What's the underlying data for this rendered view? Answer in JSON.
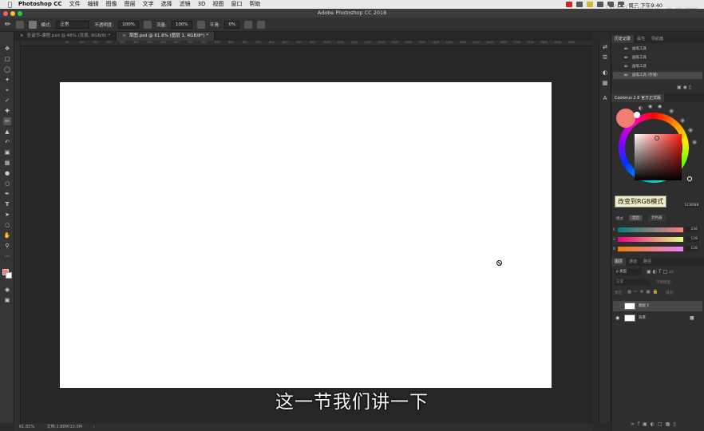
{
  "menubar": {
    "app": "Photoshop CC",
    "items": [
      "文件",
      "编辑",
      "图像",
      "图层",
      "文字",
      "选择",
      "滤镜",
      "3D",
      "视图",
      "窗口",
      "帮助"
    ],
    "clock": "周三 下午9:40",
    "watermark": "YiiHuu.com"
  },
  "window": {
    "title": "Adobe Photoshop CC 2018"
  },
  "options": {
    "mode_label": "模式:",
    "mode_value": "正常",
    "opacity_label": "不透明度:",
    "opacity_value": "100%",
    "flow_label": "流量:",
    "flow_value": "100%",
    "smooth_label": "平滑:",
    "smooth_value": "0%"
  },
  "tabs": [
    {
      "label": "圣诞节-课程.psd @ 48% (背景, RGB/8) *",
      "active": false
    },
    {
      "label": "草图.psd @ 61.8% (图层 1, RGB/8*) *",
      "active": true
    }
  ],
  "ruler": {
    "top_ticks": [
      "50",
      "100",
      "150",
      "200",
      "250",
      "300",
      "350",
      "400",
      "450",
      "500",
      "550",
      "600",
      "650",
      "700",
      "750",
      "800",
      "850",
      "900",
      "950",
      "1000",
      "1050",
      "1100",
      "1150",
      "1200",
      "1250",
      "1300",
      "1350",
      "1400",
      "1450",
      "1500",
      "1550",
      "1600",
      "1650",
      "1700",
      "1750",
      "1800",
      "1850",
      "1900"
    ]
  },
  "status": {
    "zoom": "61.82%",
    "doc": "文档:3.88M/10.0M"
  },
  "subtitle": "这一节我们讲一下",
  "history": {
    "tabs": [
      "历史记录",
      "属性",
      "导航器"
    ],
    "rows": [
      {
        "label": "画笔工具",
        "selected": false
      },
      {
        "label": "画笔工具",
        "selected": false
      },
      {
        "label": "画笔工具",
        "selected": false
      },
      {
        "label": "画笔工具 (存储)",
        "selected": true
      }
    ]
  },
  "coolorus": {
    "title": "Coolorus 2.6 官方正式版",
    "tooltip": "改变到RGB模式",
    "hex": "EC8088",
    "mode_label": "模式",
    "buttons": [
      "混合",
      "混色器"
    ],
    "channels": [
      {
        "label": "R",
        "value": "236"
      },
      {
        "label": "G",
        "value": "128"
      },
      {
        "label": "B",
        "value": "128"
      }
    ],
    "accent": "#f27d72"
  },
  "layers": {
    "tabs": [
      "图层",
      "通道",
      "路径"
    ],
    "filter_label": "ρ 类型",
    "blend": "正常",
    "opacity_label": "不透明度:",
    "lock_label": "锁定:",
    "fill_label": "填充:",
    "items": [
      {
        "name": "图层 1",
        "selected": true,
        "visible": false
      },
      {
        "name": "背景",
        "selected": false,
        "visible": true
      }
    ]
  }
}
